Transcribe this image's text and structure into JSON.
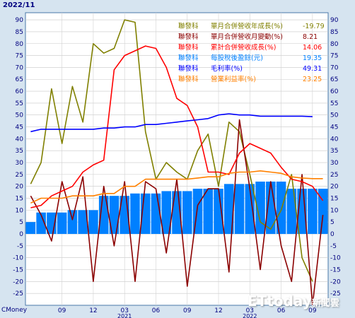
{
  "header": {
    "date": "2022/11"
  },
  "footer": {
    "brand": "CMoney"
  },
  "watermark": {
    "main": "ETtoday",
    "sub": "新聞雲"
  },
  "chart_data": {
    "type": "bar",
    "yticks": [
      90,
      85,
      80,
      75,
      70,
      65,
      60,
      55,
      50,
      45,
      40,
      35,
      30,
      25,
      20,
      15,
      10,
      5,
      0,
      -5,
      -10,
      -15,
      -20,
      -25
    ],
    "ylim": [
      -30,
      93
    ],
    "x_ticks": [
      {
        "index": 3,
        "label": "09"
      },
      {
        "index": 6,
        "label": "12"
      },
      {
        "index": 9,
        "label": "03"
      },
      {
        "index": 12,
        "label": "06"
      },
      {
        "index": 15,
        "label": "09"
      },
      {
        "index": 18,
        "label": "12"
      },
      {
        "index": 21,
        "label": "03"
      },
      {
        "index": 24,
        "label": "06"
      },
      {
        "index": 27,
        "label": "09"
      }
    ],
    "year_labels": [
      {
        "index": 9,
        "label": "2021"
      },
      {
        "index": 21,
        "label": "2022"
      }
    ],
    "n_points": 29,
    "series": [
      {
        "name": "單月合併營收年成長(%)",
        "value_text": "-19.79",
        "color": "#808000",
        "kind": "line",
        "values": [
          21,
          30,
          61,
          38,
          62,
          47,
          80,
          76,
          78,
          90,
          89,
          43,
          23,
          30,
          26,
          23,
          35,
          42,
          20,
          47,
          43,
          25,
          5,
          2,
          10,
          25,
          -10,
          -20
        ]
      },
      {
        "name": "單月合併營收月變動(%)",
        "value_text": "8.21",
        "color": "#8b0000",
        "kind": "line",
        "values": [
          16,
          8,
          -3,
          22,
          6,
          24,
          -20,
          20,
          -5,
          22,
          -20,
          22,
          19,
          -8,
          23,
          -22,
          12,
          19,
          19,
          -16,
          48,
          19,
          -15,
          22,
          -5,
          -20,
          25,
          -30,
          8
        ]
      },
      {
        "name": "累計合併營收成長(%)",
        "value_text": "14.06",
        "color": "#ff0000",
        "kind": "line",
        "values": [
          11,
          12,
          16,
          18,
          20,
          26,
          29,
          31,
          69,
          75,
          77,
          79,
          78,
          70,
          57,
          54,
          45,
          26,
          26,
          25,
          34,
          38,
          36,
          34,
          28,
          23,
          22,
          20,
          14
        ]
      },
      {
        "name": "每股稅後盈餘(元)",
        "value_text": "19.35",
        "color": "#0080ff",
        "kind": "bar",
        "values": [
          5,
          9,
          9,
          9,
          10,
          10,
          10,
          16,
          16,
          16,
          17,
          17,
          17,
          18,
          18,
          18,
          19,
          19,
          19,
          21,
          21,
          21,
          22,
          22,
          22,
          19,
          19,
          19,
          19
        ]
      },
      {
        "name": "毛利率(%)",
        "value_text": "49.31",
        "color": "#0000ff",
        "kind": "line",
        "values": [
          43,
          44,
          44,
          44,
          44,
          44,
          44,
          44.5,
          44.5,
          45,
          45,
          46,
          46,
          46.5,
          47,
          47.5,
          48,
          48.5,
          50,
          50.5,
          50,
          50,
          49.5,
          49.5,
          49.5,
          49.5,
          49.5,
          49.31
        ]
      },
      {
        "name": "營業利益率(%)",
        "value_text": "23.25",
        "color": "#ff8000",
        "kind": "line",
        "values": [
          13,
          15,
          15,
          15,
          16,
          16,
          16,
          17,
          17,
          20,
          20,
          23,
          23,
          23,
          23,
          23,
          23.5,
          24,
          24,
          25.5,
          26,
          26,
          26.5,
          26,
          25.5,
          24,
          23.5,
          23.25,
          23.25
        ]
      }
    ],
    "legend_prefix": "聯發科",
    "legend_position": "top-right",
    "grid": true
  }
}
